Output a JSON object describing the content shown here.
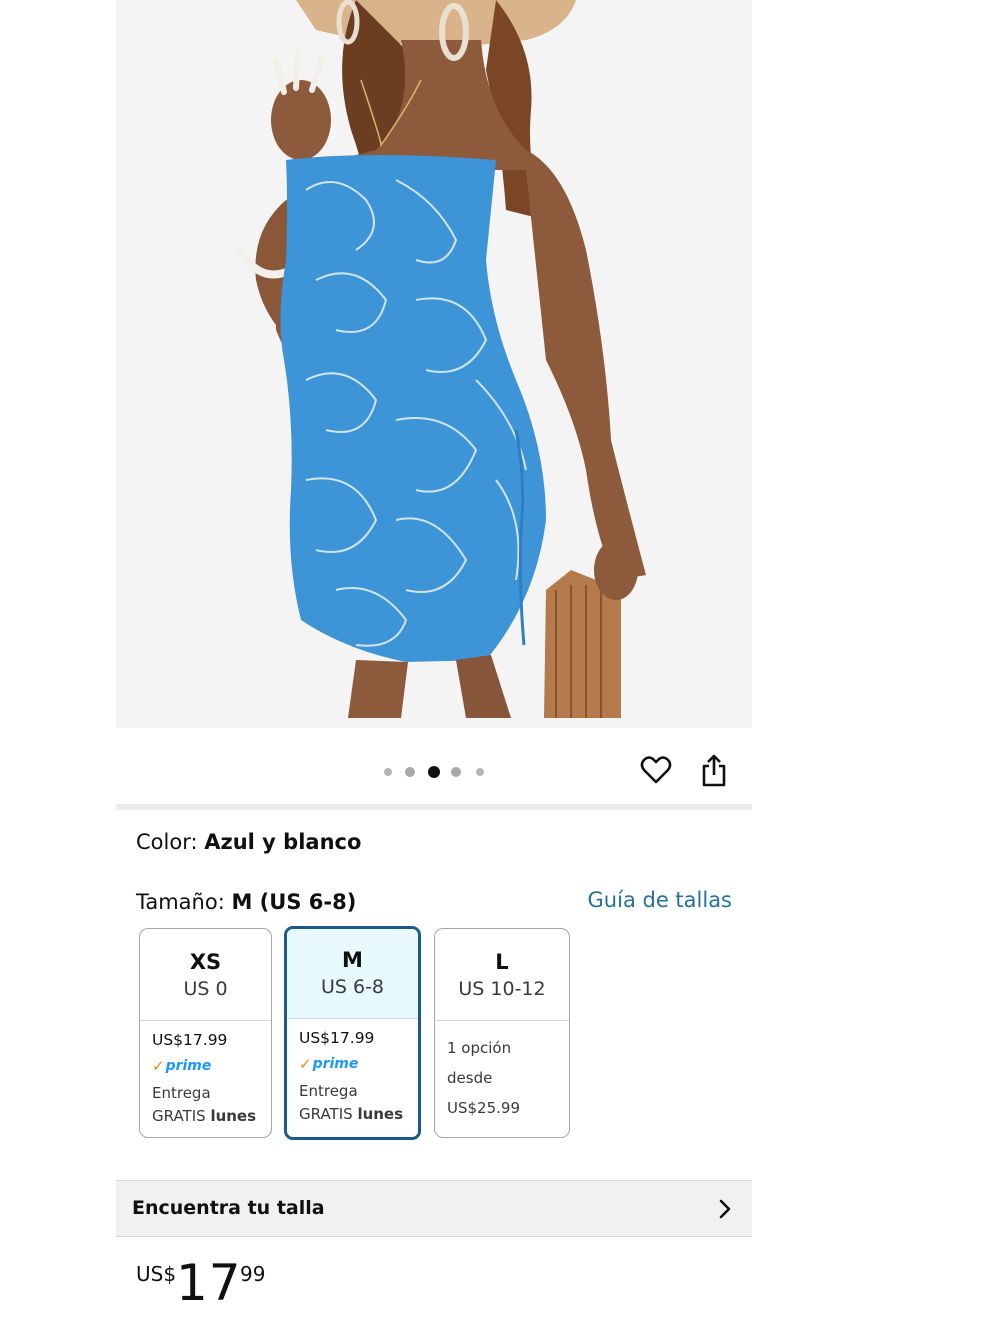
{
  "product_image": {
    "alt": "Vestido ajustado sin tirantes azul con estampado floral blanco"
  },
  "carousel": {
    "count": 5,
    "active_index": 2
  },
  "actions": {
    "favorite_icon": "heart-icon",
    "share_icon": "share-icon"
  },
  "color": {
    "label": "Color:",
    "value": "Azul y blanco"
  },
  "size": {
    "label": "Tamaño:",
    "value": "M (US 6-8)",
    "guide_link": "Guía de tallas"
  },
  "size_options": [
    {
      "size": "XS",
      "us": "US 0",
      "price": "US$17.99",
      "prime": "prime",
      "delivery_line1": "Entrega",
      "delivery_line2_a": "GRATIS",
      "delivery_line2_b": "lunes",
      "selected": false
    },
    {
      "size": "M",
      "us": "US 6-8",
      "price": "US$17.99",
      "prime": "prime",
      "delivery_line1": "Entrega",
      "delivery_line2_a": "GRATIS",
      "delivery_line2_b": "lunes",
      "selected": true
    },
    {
      "size": "L",
      "us": "US 10-12",
      "options_text": "1 opción desde",
      "options_price": "US$25.99",
      "selected": false
    }
  ],
  "find_size": {
    "label": "Encuentra tu talla"
  },
  "price": {
    "currency": "US$",
    "whole": "17",
    "fraction": "99"
  },
  "colors": {
    "link": "#2470a0",
    "selected_border": "#1c5a8e",
    "selected_bg": "#e8f9fc",
    "prime_blue": "#1a98ff",
    "prime_check": "#f08804",
    "dress_blue": "#3d94d6"
  }
}
